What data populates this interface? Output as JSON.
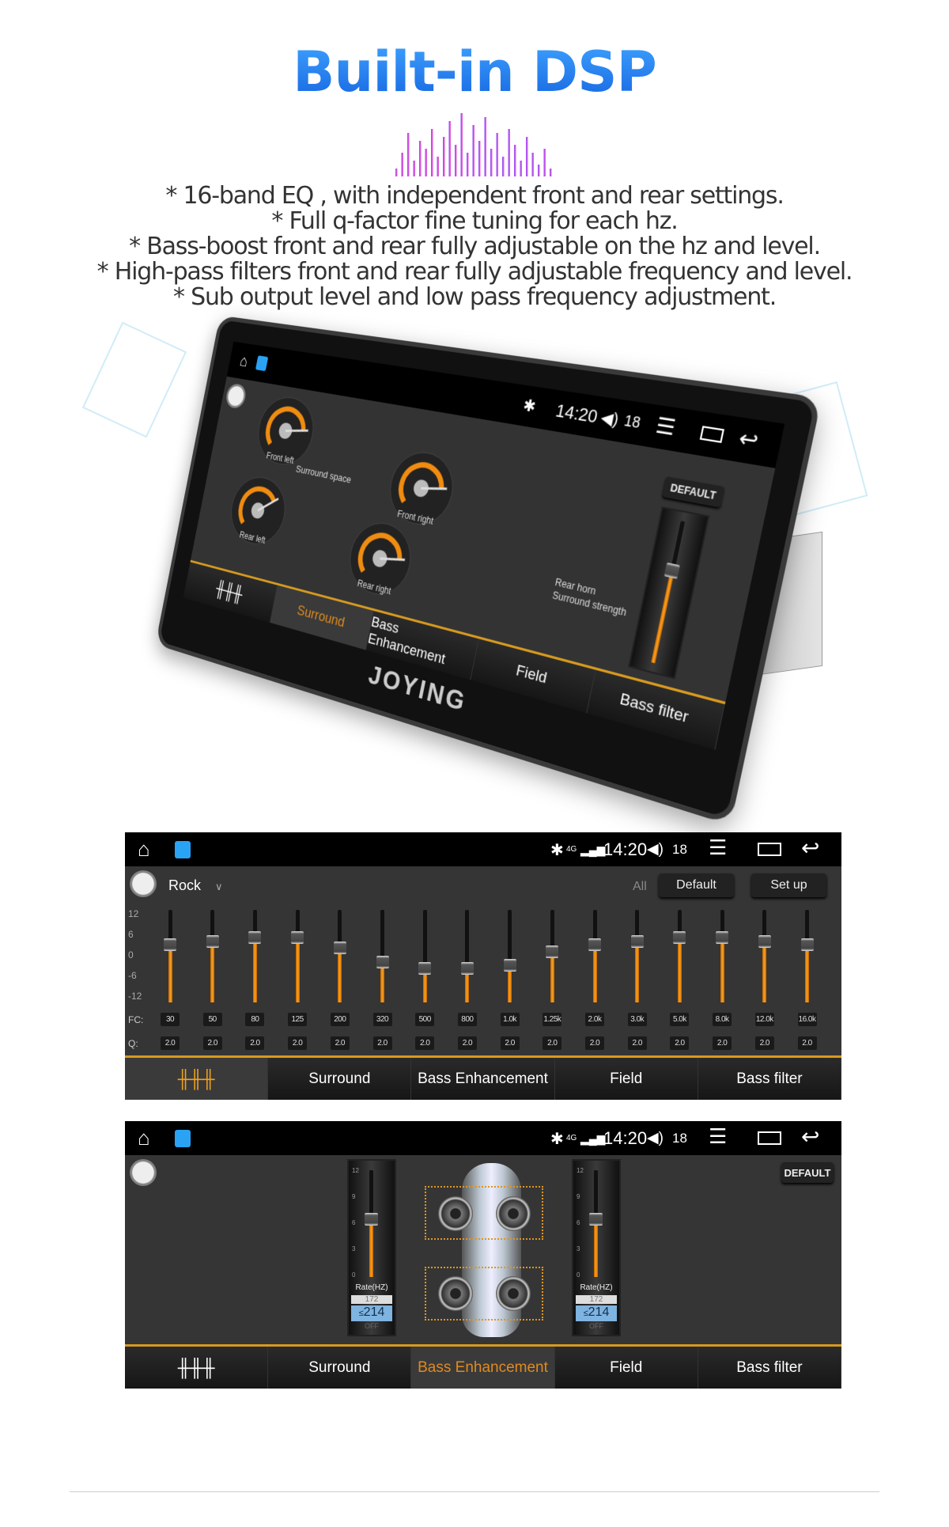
{
  "header": {
    "title": "Built-in DSP",
    "features": [
      "* 16-band EQ , with independent front and rear settings.",
      "* Full q-factor fine tuning for each hz.",
      "* Bass-boost front and rear fully adjustable on the hz and level.",
      "* High-pass filters front and rear fully adjustable frequency and level.",
      "* Sub output level and  low pass frequency adjustment."
    ]
  },
  "colors": {
    "accent": "#e08a1e",
    "title_blue": "#2a7de8",
    "wave_start": "#8a4dff",
    "wave_end": "#ff5fd0"
  },
  "status": {
    "time": "14:20",
    "volume": "18",
    "network": "4G",
    "icons": [
      "home-icon",
      "app-icon",
      "bluetooth-icon",
      "signal-icon",
      "volume-icon",
      "menu-icon",
      "recent-apps-icon",
      "back-icon"
    ]
  },
  "tabs": {
    "eq_icon": "equalizer-icon",
    "surround": "Surround",
    "bass": "Bass Enhancement",
    "field": "Field",
    "bass_filter": "Bass filter"
  },
  "device": {
    "logo": "JOYING",
    "default": "DEFAULT",
    "surround_space": "Surround space",
    "rear_horn": "Rear horn",
    "surround_strength": "Surround strength",
    "gauges": [
      {
        "label": "Front left",
        "value": 80
      },
      {
        "label": "Front right",
        "value": 80
      },
      {
        "label": "Rear left",
        "value": 70
      },
      {
        "label": "Rear right",
        "value": 80
      }
    ],
    "strength_value": 3,
    "strength_range": [
      -10,
      10
    ],
    "active_tab": "Surround"
  },
  "eq": {
    "preset": "Rock",
    "all": "All",
    "default": "Default",
    "setup": "Set up",
    "fc_label": "FC:",
    "q_label": "Q:",
    "y_ticks": [
      "12",
      "6",
      "0",
      "-6",
      "-12"
    ],
    "bands": [
      {
        "fc": "30",
        "q": "2.0",
        "gain": 3
      },
      {
        "fc": "50",
        "q": "2.0",
        "gain": 4
      },
      {
        "fc": "80",
        "q": "2.0",
        "gain": 5
      },
      {
        "fc": "125",
        "q": "2.0",
        "gain": 5
      },
      {
        "fc": "200",
        "q": "2.0",
        "gain": 2
      },
      {
        "fc": "320",
        "q": "2.0",
        "gain": -2
      },
      {
        "fc": "500",
        "q": "2.0",
        "gain": -4
      },
      {
        "fc": "800",
        "q": "2.0",
        "gain": -4
      },
      {
        "fc": "1.0k",
        "q": "2.0",
        "gain": -3
      },
      {
        "fc": "1.25k",
        "q": "2.0",
        "gain": 1
      },
      {
        "fc": "2.0k",
        "q": "2.0",
        "gain": 3
      },
      {
        "fc": "3.0k",
        "q": "2.0",
        "gain": 4
      },
      {
        "fc": "5.0k",
        "q": "2.0",
        "gain": 5
      },
      {
        "fc": "8.0k",
        "q": "2.0",
        "gain": 5
      },
      {
        "fc": "12.0k",
        "q": "2.0",
        "gain": 4
      },
      {
        "fc": "16.0k",
        "q": "2.0",
        "gain": 3
      }
    ]
  },
  "bass": {
    "default": "DEFAULT",
    "active_tab": "Bass Enhancement",
    "scale": [
      "12",
      "9",
      "6",
      "3",
      "0"
    ],
    "front": {
      "level": 7,
      "rate_label": "Rate(HZ)",
      "prev": "172",
      "value": "214",
      "next": "OFF"
    },
    "rear": {
      "level": 7,
      "rate_label": "Rate(HZ)",
      "prev": "172",
      "value": "214",
      "next": "OFF"
    }
  }
}
